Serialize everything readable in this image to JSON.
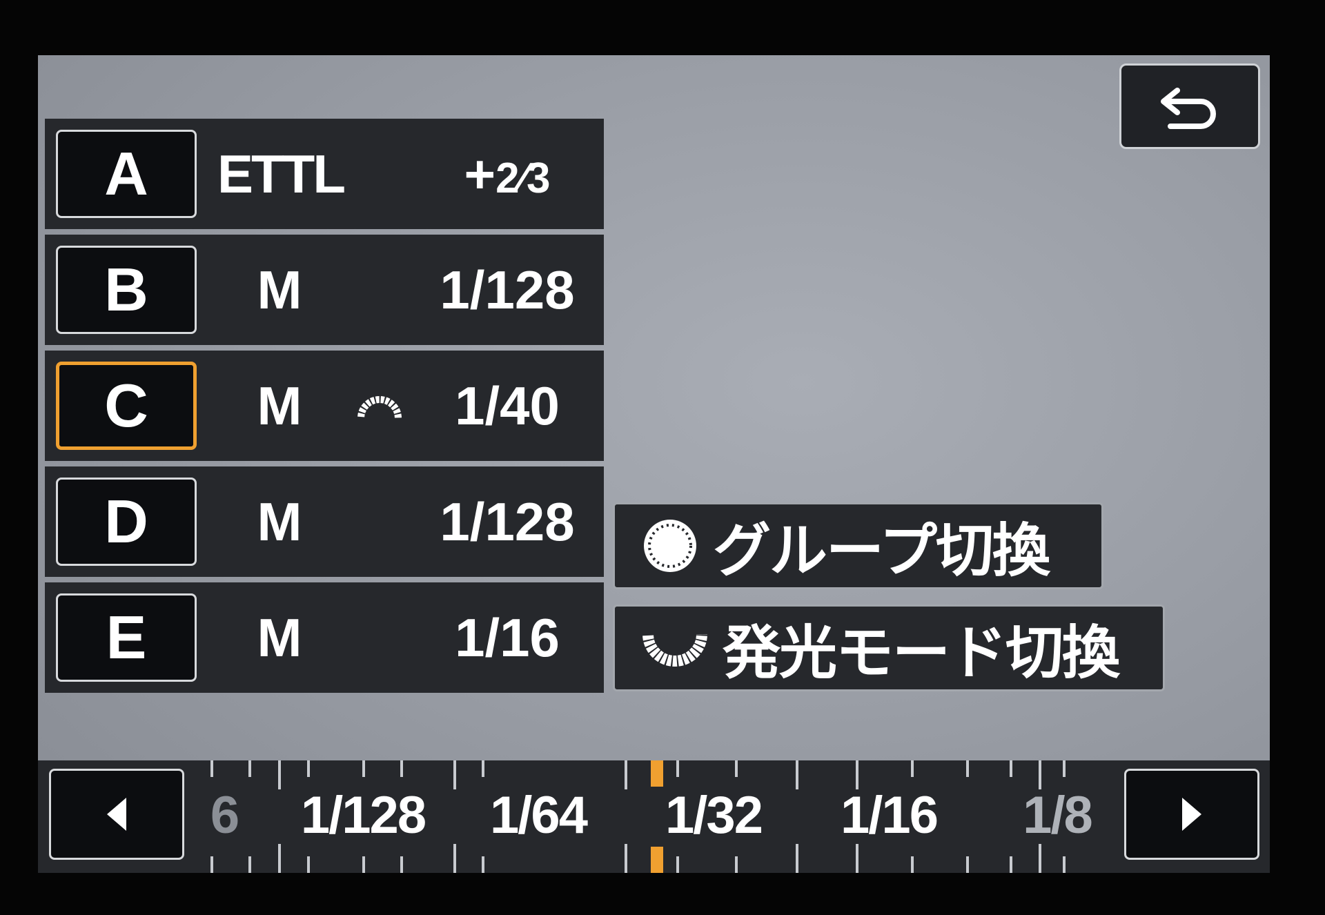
{
  "groups": [
    {
      "letter": "A",
      "mode": "ETTL",
      "value": "+2/3",
      "value_main": "+",
      "value_frac": "2⁄3"
    },
    {
      "letter": "B",
      "mode": "M",
      "value": "1/128"
    },
    {
      "letter": "C",
      "mode": "M",
      "value": "1/40",
      "selected": true
    },
    {
      "letter": "D",
      "mode": "M",
      "value": "1/128"
    },
    {
      "letter": "E",
      "mode": "M",
      "value": "1/16"
    }
  ],
  "actions": {
    "group_switch_label": "グループ切換",
    "flash_mode_switch_label": "発光モード切換"
  },
  "scale": {
    "labels": [
      "6",
      "1/128",
      "1/64",
      "1/32",
      "1/16",
      "1/8"
    ],
    "current_value": "1/40"
  },
  "icons": {
    "back": "return-arrow-icon",
    "prev": "left-arrow-icon",
    "next": "right-arrow-icon",
    "dial_selected": "dial-arc-icon",
    "dial_front": "front-dial-icon",
    "dial_rear": "rear-dial-icon"
  },
  "colors": {
    "accent": "#f0a030",
    "panel": "#26282c",
    "background": "#9a9ea6"
  }
}
